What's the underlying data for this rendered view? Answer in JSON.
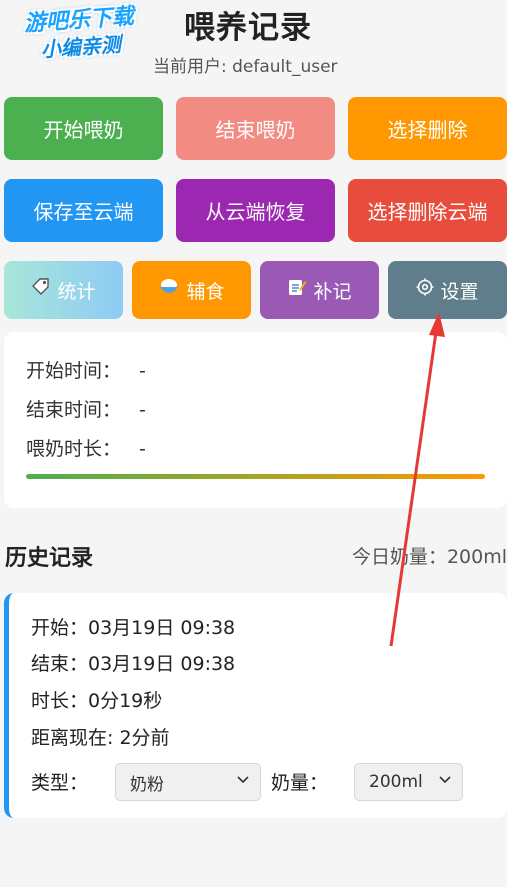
{
  "header": {
    "logo_line1": "游吧乐下载",
    "logo_line2": "小编亲测",
    "title": "喂养记录",
    "current_user": "当前用户: default_user"
  },
  "buttons": {
    "start_feeding": "开始喂奶",
    "end_feeding": "结束喂奶",
    "select_delete": "选择删除",
    "save_cloud": "保存至云端",
    "restore_cloud": "从云端恢复",
    "select_delete_cloud": "选择删除云端",
    "stats": "统计",
    "solid_food": "辅食",
    "add_record": "补记",
    "settings": "设置"
  },
  "status": {
    "start_label": "开始时间：",
    "start_value": "-",
    "end_label": "结束时间：",
    "end_value": "-",
    "duration_label": "喂奶时长：",
    "duration_value": "-"
  },
  "history": {
    "title": "历史记录",
    "today_amount": "今日奶量：200ml",
    "records": [
      {
        "start": "开始：03月19日 09:38",
        "end": "结束：03月19日 09:38",
        "duration": "时长：0分19秒",
        "ago": "距离现在: 2分前",
        "type_label": "类型：",
        "type_value": "奶粉",
        "amount_label": "奶量：",
        "amount_value": "200ml"
      }
    ]
  },
  "icons": {
    "stats": "tag-icon",
    "solid_food": "rice-bowl-icon",
    "add_record": "memo-icon",
    "settings": "gear-icon"
  },
  "colors": {
    "start": "#4caf50",
    "end": "#f28b82",
    "delete": "#ff9800",
    "save_cloud": "#2196f3",
    "restore_cloud": "#9c27b0",
    "delete_cloud": "#e74c3c",
    "settings": "#607d8b",
    "annotation": "#e53935"
  }
}
